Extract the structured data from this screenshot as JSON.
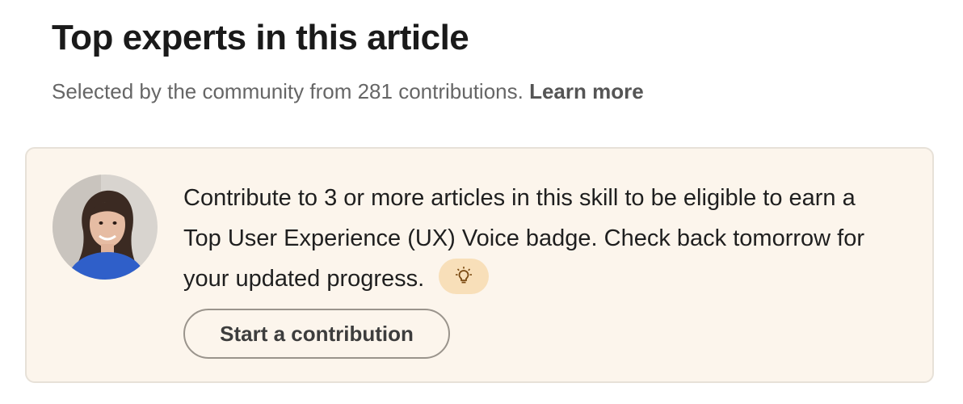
{
  "section": {
    "title": "Top experts in this article",
    "subtitle_text": "Selected by the community from 281 contributions.",
    "learn_more_label": "Learn more"
  },
  "card": {
    "message": "Contribute to 3 or more articles in this skill to be eligible to earn a Top User Experience (UX) Voice badge. Check back tomorrow for your updated progress.",
    "bulb_icon": "lightbulb-icon",
    "button_label": "Start a contribution",
    "background_color": "#fcf5ec",
    "badge_color": "#f8dfb9"
  }
}
